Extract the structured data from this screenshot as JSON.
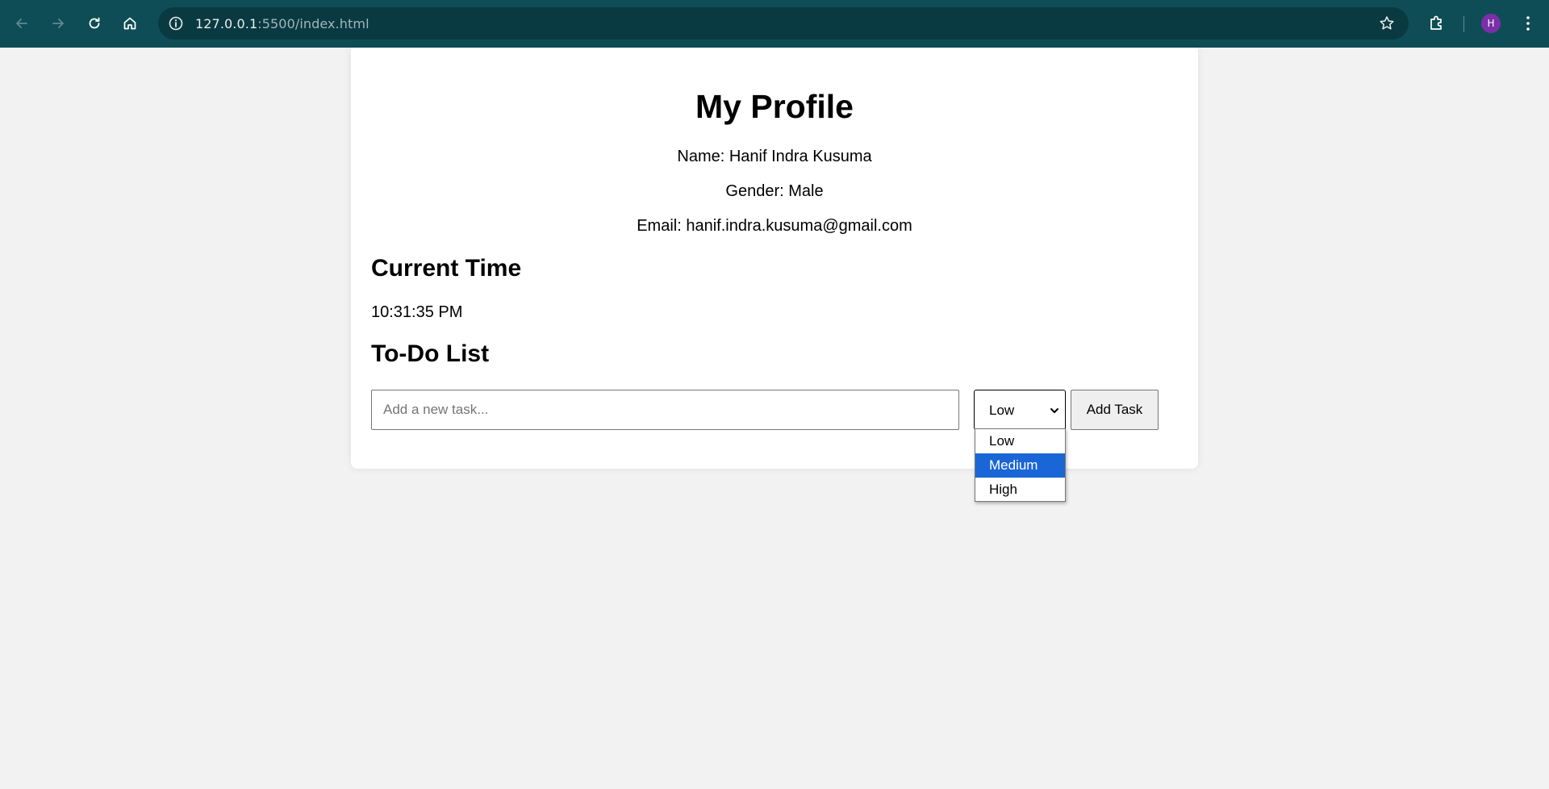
{
  "browser": {
    "url_host": "127.0.0.1",
    "url_rest": ":5500/index.html",
    "profile_initial": "H",
    "colors": {
      "toolbar": "#0e4d55",
      "omnibox": "#0a3a41",
      "avatar": "#7b2fa8"
    },
    "icons": [
      "back-icon",
      "forward-icon",
      "reload-icon",
      "home-icon",
      "site-info-icon",
      "bookmark-star-icon",
      "extensions-icon",
      "profile-avatar",
      "kebab-menu-icon"
    ]
  },
  "profile": {
    "title": "My Profile",
    "name_line": "Name: Hanif Indra Kusuma",
    "gender_line": "Gender: Male",
    "email_line": "Email: hanif.indra.kusuma@gmail.com"
  },
  "time": {
    "heading": "Current Time",
    "value": "10:31:35 PM"
  },
  "todo": {
    "heading": "To-Do List",
    "input_placeholder": "Add a new task...",
    "input_value": "",
    "priority_selected": "Low",
    "priority_options": [
      "Low",
      "Medium",
      "High"
    ],
    "priority_highlighted": "Medium",
    "add_button_label": "Add Task",
    "highlight_color": "#1a66d6"
  }
}
